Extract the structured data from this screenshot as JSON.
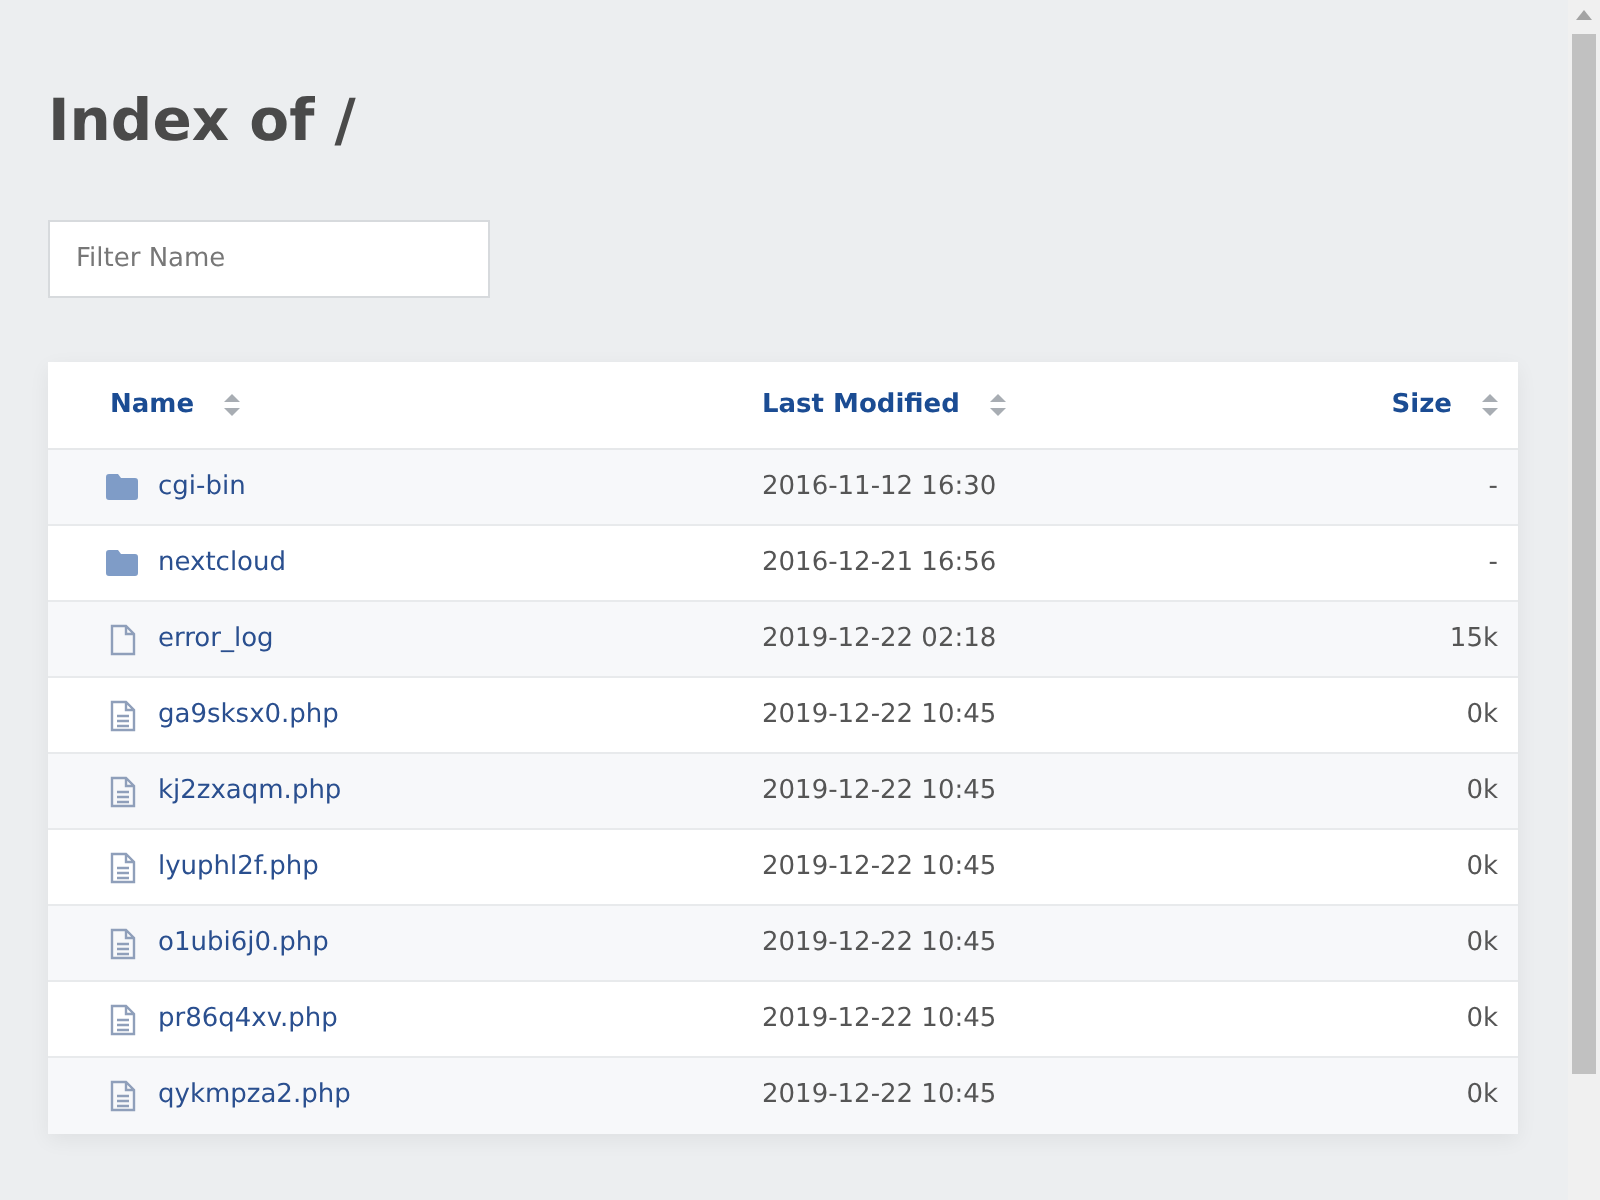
{
  "title": "Index of /",
  "filter": {
    "placeholder": "Filter Name"
  },
  "columns": [
    {
      "label": "Name"
    },
    {
      "label": "Last Modified"
    },
    {
      "label": "Size"
    }
  ],
  "rows": [
    {
      "kind": "folder",
      "name": "cgi-bin",
      "modified": "2016-11-12 16:30",
      "size": "-"
    },
    {
      "kind": "folder",
      "name": "nextcloud",
      "modified": "2016-12-21 16:56",
      "size": "-"
    },
    {
      "kind": "file",
      "name": "error_log",
      "modified": "2019-12-22 02:18",
      "size": "15k"
    },
    {
      "kind": "text",
      "name": "ga9sksx0.php",
      "modified": "2019-12-22 10:45",
      "size": "0k"
    },
    {
      "kind": "text",
      "name": "kj2zxaqm.php",
      "modified": "2019-12-22 10:45",
      "size": "0k"
    },
    {
      "kind": "text",
      "name": "lyuphl2f.php",
      "modified": "2019-12-22 10:45",
      "size": "0k"
    },
    {
      "kind": "text",
      "name": "o1ubi6j0.php",
      "modified": "2019-12-22 10:45",
      "size": "0k"
    },
    {
      "kind": "text",
      "name": "pr86q4xv.php",
      "modified": "2019-12-22 10:45",
      "size": "0k"
    },
    {
      "kind": "text",
      "name": "qykmpza2.php",
      "modified": "2019-12-22 10:45",
      "size": "0k"
    }
  ]
}
